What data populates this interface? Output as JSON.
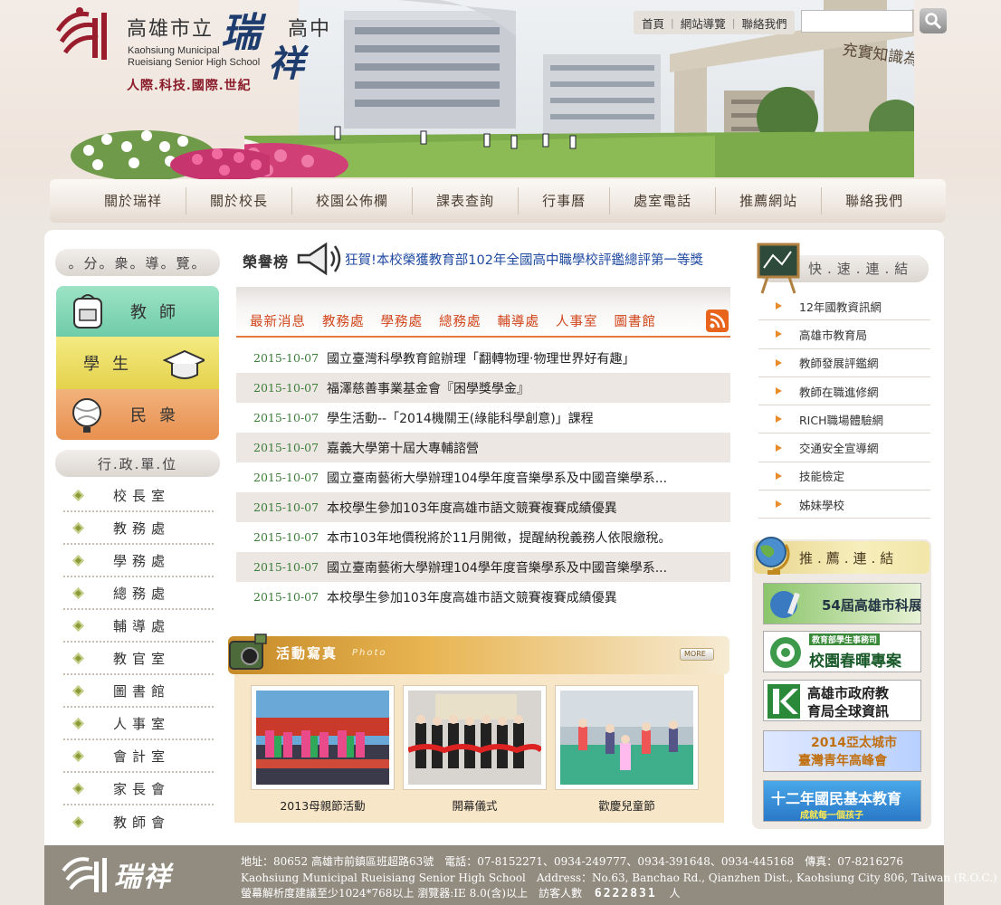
{
  "header": {
    "school_cn_a": "高雄市立",
    "school_cn_rui": "瑞",
    "school_cn_xiang": "祥",
    "school_cn_b": "高中",
    "school_en_line1": "Kaohsiung Municipal",
    "school_en_line2": "Rueisiang Senior High School",
    "motto": "人際.科技.國際.世紀",
    "top_links": [
      "首頁",
      "網站導覽",
      "聯絡我們"
    ],
    "search_placeholder": ""
  },
  "nav": [
    "關於瑞祥",
    "關於校長",
    "校園公佈欄",
    "課表查詢",
    "行事曆",
    "處室電話",
    "推薦網站",
    "聯絡我們"
  ],
  "left": {
    "audience_title": "。分。衆。導。覽。",
    "audiences": [
      {
        "label": "教師",
        "color": "#7fd6b4",
        "icon": "backpack-icon"
      },
      {
        "label": "學生",
        "color": "#ede16a",
        "icon": "graduation-cap-icon"
      },
      {
        "label": "民衆",
        "color": "#ec9f64",
        "icon": "globe-icon"
      }
    ],
    "admin_title": "行.政.單.位",
    "admin_units": [
      "校長室",
      "教務處",
      "學務處",
      "總務處",
      "輔導處",
      "教官室",
      "圖書館",
      "人事室",
      "會計室",
      "家長會",
      "教師會"
    ]
  },
  "honor": {
    "label": "榮譽榜",
    "text": "狂賀!本校榮獲教育部102年全國高中職學校評鑑總評第一等獎"
  },
  "news_tabs": [
    "最新消息",
    "教務處",
    "學務處",
    "總務處",
    "輔導處",
    "人事室",
    "圖書館"
  ],
  "news": [
    {
      "date": "2015-10-07",
      "title": "國立臺灣科學教育館辦理「翻轉物理‧物理世界好有趣」"
    },
    {
      "date": "2015-10-07",
      "title": "福澤慈善事業基金會『困學獎學金』"
    },
    {
      "date": "2015-10-07",
      "title": "學生活動--「2014機關王(綠能科學創意)」課程"
    },
    {
      "date": "2015-10-07",
      "title": "嘉義大學第十屆大專輔諮營"
    },
    {
      "date": "2015-10-07",
      "title": "國立臺南藝術大學辦理104學年度音樂學系及中國音樂學系..."
    },
    {
      "date": "2015-10-07",
      "title": "本校學生參加103年度高雄市語文競賽複賽成績優異"
    },
    {
      "date": "2015-10-07",
      "title": "本市103年地價稅將於11月開徵，提醒納稅義務人依限繳稅。"
    },
    {
      "date": "2015-10-07",
      "title": "國立臺南藝術大學辦理104學年度音樂學系及中國音樂學系..."
    },
    {
      "date": "2015-10-07",
      "title": "本校學生參加103年度高雄市語文競賽複賽成績優異"
    }
  ],
  "activity": {
    "title": "活動寫真",
    "title_en": "Photo",
    "more": "MORE",
    "photos": [
      {
        "caption": "2013母親節活動"
      },
      {
        "caption": "開幕儀式"
      },
      {
        "caption": "歡慶兒童節"
      }
    ]
  },
  "quick": {
    "title": "快.速.連.結",
    "links": [
      "12年國教資訊網",
      "高雄市教育局",
      "教師發展評鑑網",
      "教師在職進修網",
      "RICH職場體驗網",
      "交通安全宣導網",
      "技能檢定",
      "姊妹學校"
    ]
  },
  "recommend": {
    "title": "推.薦.連.結",
    "banners": [
      {
        "text": "54屆高雄市科展"
      },
      {
        "text_small": "教育部學生事務司",
        "text": "校園春暉專案"
      },
      {
        "text": "高雄市政府教",
        "text2": "育局全球資訊"
      },
      {
        "text": "2014亞太城市",
        "text2": "臺灣青年高峰會"
      },
      {
        "text": "十二年國民基本教育",
        "text2": "成就每一個孩子"
      }
    ]
  },
  "footer": {
    "logo_text": "瑞祥",
    "line1": "地址：80652 高雄市前鎮區班超路63號　電話：07-8152271、0934-249777、0934-391648、0934-445168　傳真：07-8216276",
    "line2": "Kaohsiung Municipal Rueisiang Senior High School　Address：No.63, Banchao Rd., Qianzhen Dist., Kaohsiung City 806, Taiwan (R.O.C.)",
    "line3_prefix": "螢幕解析度建議至少1024*768以上 瀏覽器:IE 8.0(含)以上　訪客人數",
    "visitor_count": "6222831",
    "line3_suffix": "人"
  },
  "colors": {
    "accent_red": "#8a1c2a",
    "tab_orange": "#d0451b",
    "date_green": "#3c7d3a",
    "footer_bg": "#928b80"
  }
}
